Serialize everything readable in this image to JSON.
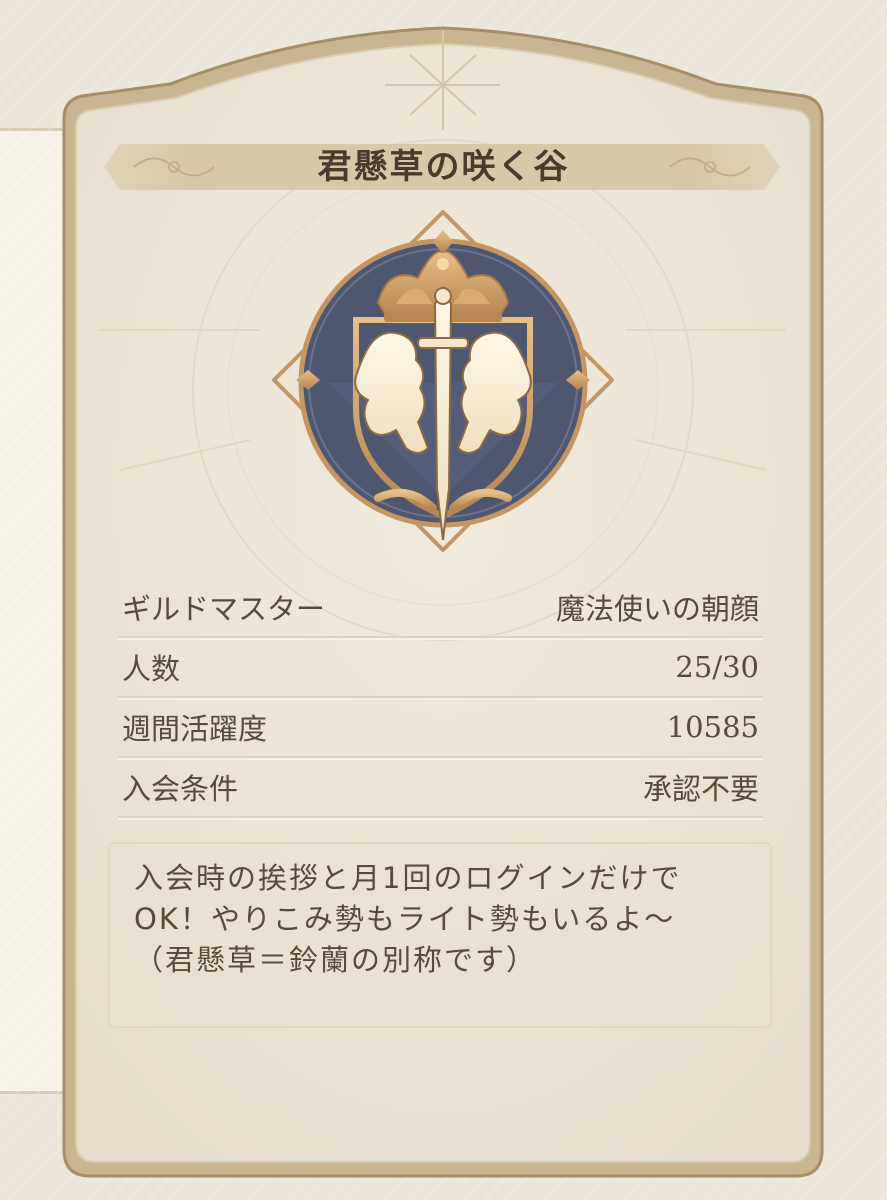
{
  "guild": {
    "name": "君懸草の咲く谷",
    "emblem_icon": "lion-crown-sword-crest-icon"
  },
  "info": [
    {
      "label": "ギルドマスター",
      "value": "魔法使いの朝顔"
    },
    {
      "label": "人数",
      "value": "25/30"
    },
    {
      "label": "週間活躍度",
      "value": "10585"
    },
    {
      "label": "入会条件",
      "value": "承認不要"
    }
  ],
  "description": {
    "lines": [
      "入会時の挨拶と月1回のログインだけで",
      "OK！やりこみ勢もライト勢もいるよ〜",
      "（君懸草＝鈴蘭の別称です）"
    ]
  },
  "colors": {
    "frame": "#b49b72",
    "card": "#ece5d5",
    "text": "#5a4a3b",
    "emblem_dark": "#4f5670",
    "emblem_gold": "#c9995c"
  }
}
